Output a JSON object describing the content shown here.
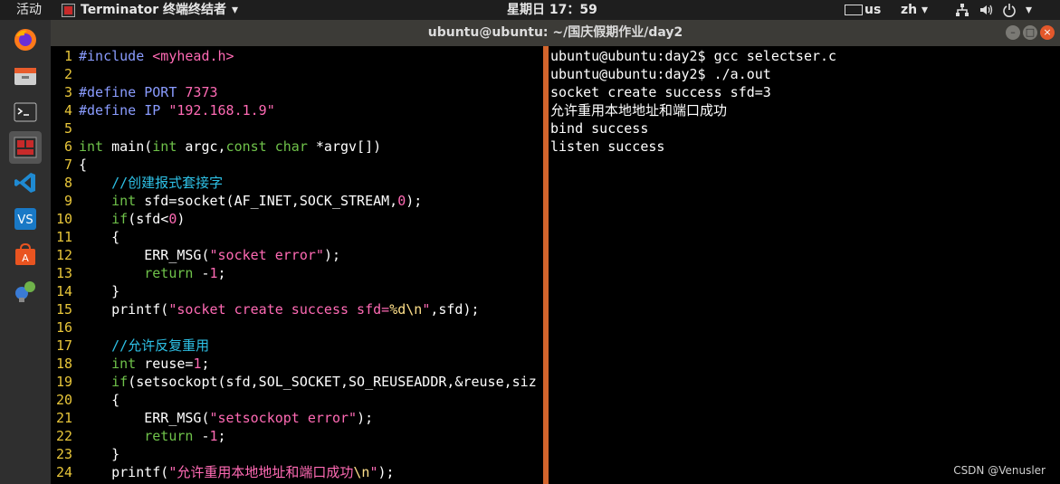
{
  "topbar": {
    "activities": "活动",
    "app_name": "Terminator 终端终结者",
    "app_menu_arrow": "▾",
    "clock": "星期日 17：59",
    "keyboard_layout": "us",
    "input_method": "zh",
    "input_method_arrow": "▾",
    "tray_icons": [
      "network-icon",
      "volume-icon",
      "power-icon"
    ],
    "tray_arrow": "▾"
  },
  "dock": {
    "items": [
      "firefox-icon",
      "files-icon",
      "terminal-icon",
      "terminator-icon",
      "vscode-icon",
      "virtualbox-icon",
      "software-center-icon",
      "network-tools-icon"
    ]
  },
  "window": {
    "title": "ubuntu@ubuntu: ~/国庆假期作业/day2",
    "buttons": [
      "minimize",
      "maximize",
      "close"
    ]
  },
  "editor": {
    "lines": [
      {
        "n": "1",
        "parts": [
          {
            "t": "#include ",
            "c": "pp"
          },
          {
            "t": "<myhead.h>",
            "c": "s"
          }
        ]
      },
      {
        "n": "2",
        "parts": []
      },
      {
        "n": "3",
        "parts": [
          {
            "t": "#define ",
            "c": "pp"
          },
          {
            "t": "PORT ",
            "c": "pp"
          },
          {
            "t": "7373",
            "c": "n"
          }
        ]
      },
      {
        "n": "4",
        "parts": [
          {
            "t": "#define ",
            "c": "pp"
          },
          {
            "t": "IP ",
            "c": "pp"
          },
          {
            "t": "\"192.168.1.9\"",
            "c": "s"
          }
        ]
      },
      {
        "n": "5",
        "parts": []
      },
      {
        "n": "6",
        "parts": [
          {
            "t": "int",
            "c": "k"
          },
          {
            "t": " main(",
            "c": ""
          },
          {
            "t": "int",
            "c": "k"
          },
          {
            "t": " argc,",
            "c": ""
          },
          {
            "t": "const",
            "c": "k"
          },
          {
            "t": " ",
            "c": ""
          },
          {
            "t": "char",
            "c": "k"
          },
          {
            "t": " *argv[])",
            "c": ""
          }
        ]
      },
      {
        "n": "7",
        "parts": [
          {
            "t": "{",
            "c": ""
          }
        ]
      },
      {
        "n": "8",
        "parts": [
          {
            "t": "    //创建报式套接字",
            "c": "c"
          }
        ]
      },
      {
        "n": "9",
        "parts": [
          {
            "t": "    ",
            "c": ""
          },
          {
            "t": "int",
            "c": "k"
          },
          {
            "t": " sfd=socket(AF_INET,SOCK_STREAM,",
            "c": ""
          },
          {
            "t": "0",
            "c": "n"
          },
          {
            "t": ");",
            "c": ""
          }
        ]
      },
      {
        "n": "10",
        "parts": [
          {
            "t": "    ",
            "c": ""
          },
          {
            "t": "if",
            "c": "k"
          },
          {
            "t": "(sfd<",
            "c": ""
          },
          {
            "t": "0",
            "c": "n"
          },
          {
            "t": ")",
            "c": ""
          }
        ]
      },
      {
        "n": "11",
        "parts": [
          {
            "t": "    {",
            "c": ""
          }
        ]
      },
      {
        "n": "12",
        "parts": [
          {
            "t": "        ERR_MSG(",
            "c": ""
          },
          {
            "t": "\"socket error\"",
            "c": "s"
          },
          {
            "t": ");",
            "c": ""
          }
        ]
      },
      {
        "n": "13",
        "parts": [
          {
            "t": "        ",
            "c": ""
          },
          {
            "t": "return",
            "c": "k"
          },
          {
            "t": " -",
            "c": ""
          },
          {
            "t": "1",
            "c": "n"
          },
          {
            "t": ";",
            "c": ""
          }
        ]
      },
      {
        "n": "14",
        "parts": [
          {
            "t": "    }",
            "c": ""
          }
        ]
      },
      {
        "n": "15",
        "parts": [
          {
            "t": "    printf(",
            "c": ""
          },
          {
            "t": "\"socket create success sfd=",
            "c": "s"
          },
          {
            "t": "%d\\n",
            "c": "sp"
          },
          {
            "t": "\"",
            "c": "s"
          },
          {
            "t": ",sfd);",
            "c": ""
          }
        ]
      },
      {
        "n": "16",
        "parts": []
      },
      {
        "n": "17",
        "parts": [
          {
            "t": "    //允许反复重用",
            "c": "c"
          }
        ]
      },
      {
        "n": "18",
        "parts": [
          {
            "t": "    ",
            "c": ""
          },
          {
            "t": "int",
            "c": "k"
          },
          {
            "t": " reuse=",
            "c": ""
          },
          {
            "t": "1",
            "c": "n"
          },
          {
            "t": ";",
            "c": ""
          }
        ]
      },
      {
        "n": "19",
        "parts": [
          {
            "t": "    ",
            "c": ""
          },
          {
            "t": "if",
            "c": "k"
          },
          {
            "t": "(setsockopt(sfd,SOL_SOCKET,SO_REUSEADDR,&reuse,siz",
            "c": ""
          }
        ]
      },
      {
        "n": "20",
        "parts": [
          {
            "t": "    {",
            "c": ""
          }
        ]
      },
      {
        "n": "21",
        "parts": [
          {
            "t": "        ERR_MSG(",
            "c": ""
          },
          {
            "t": "\"setsockopt error\"",
            "c": "s"
          },
          {
            "t": ");",
            "c": ""
          }
        ]
      },
      {
        "n": "22",
        "parts": [
          {
            "t": "        ",
            "c": ""
          },
          {
            "t": "return",
            "c": "k"
          },
          {
            "t": " -",
            "c": ""
          },
          {
            "t": "1",
            "c": "n"
          },
          {
            "t": ";",
            "c": ""
          }
        ]
      },
      {
        "n": "23",
        "parts": [
          {
            "t": "    }",
            "c": ""
          }
        ]
      },
      {
        "n": "24",
        "parts": [
          {
            "t": "    printf(",
            "c": ""
          },
          {
            "t": "\"允许重用本地地址和端口成功",
            "c": "s"
          },
          {
            "t": "\\n",
            "c": "sp"
          },
          {
            "t": "\"",
            "c": "s"
          },
          {
            "t": ");",
            "c": ""
          }
        ]
      }
    ]
  },
  "terminal": {
    "lines": [
      "ubuntu@ubuntu:day2$ gcc selectser.c",
      "ubuntu@ubuntu:day2$ ./a.out",
      "socket create success sfd=3",
      "允许重用本地地址和端口成功",
      "bind success",
      "listen success"
    ]
  },
  "watermark": "CSDN @Venusler",
  "colors": {
    "line_number": "#e8c63a",
    "keyword": "#6fc24a",
    "string": "#ff6ab4",
    "comment": "#2ec1e6",
    "divider": "#d2642c"
  }
}
